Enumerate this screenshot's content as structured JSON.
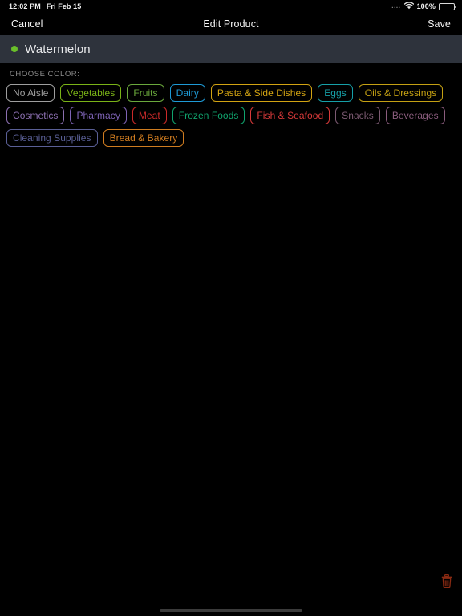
{
  "status_bar": {
    "time": "12:02 PM",
    "date": "Fri Feb 15",
    "signal_dots": "....",
    "wifi_icon": "wifi-icon",
    "battery_percent": "100%",
    "battery_level": 100
  },
  "nav_bar": {
    "cancel_label": "Cancel",
    "title": "Edit Product",
    "save_label": "Save"
  },
  "product_header": {
    "name": "Watermelon",
    "dot_color": "#6abf2a"
  },
  "content": {
    "section_label": "CHOOSE COLOR:",
    "chips": [
      {
        "label": "No Aisle",
        "color": "#9e9e9e"
      },
      {
        "label": "Vegetables",
        "color": "#7ab317"
      },
      {
        "label": "Fruits",
        "color": "#6aa83c"
      },
      {
        "label": "Dairy",
        "color": "#1e9ad6"
      },
      {
        "label": "Pasta & Side Dishes",
        "color": "#d2a312"
      },
      {
        "label": "Eggs",
        "color": "#16a0a8"
      },
      {
        "label": "Oils & Dressings",
        "color": "#c4a013"
      },
      {
        "label": "Cosmetics",
        "color": "#8b6fb0"
      },
      {
        "label": "Pharmacy",
        "color": "#7e63b5"
      },
      {
        "label": "Meat",
        "color": "#cc2a2a"
      },
      {
        "label": "Frozen Foods",
        "color": "#10a36d"
      },
      {
        "label": "Fish & Seafood",
        "color": "#d93a3a"
      },
      {
        "label": "Snacks",
        "color": "#7c5a72"
      },
      {
        "label": "Beverages",
        "color": "#8a5c7d"
      },
      {
        "label": "Cleaning Supplies",
        "color": "#5a5f96"
      },
      {
        "label": "Bread & Bakery",
        "color": "#cf7c20"
      }
    ]
  },
  "footer": {
    "delete_icon": "trash-icon",
    "delete_color": "#8a2a12",
    "home_indicator": "home-indicator"
  }
}
